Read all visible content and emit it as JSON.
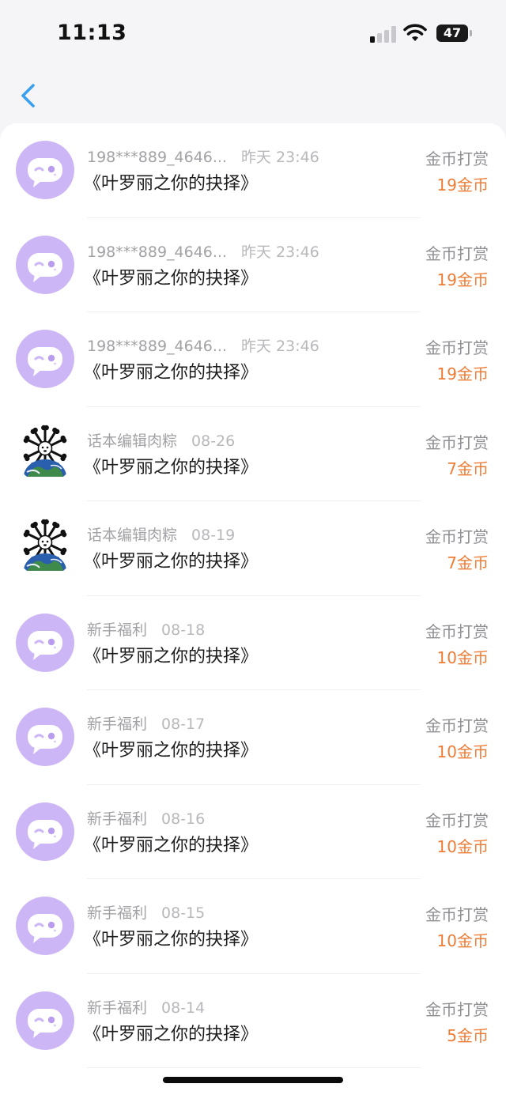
{
  "status_bar": {
    "time": "11:13",
    "battery": "47"
  },
  "colors": {
    "accent_back": "#3aa0f0",
    "amount": "#ef7c35",
    "avatar_default": "#cdb6f6"
  },
  "icons": {
    "back": "chevron-left-icon",
    "default_avatar": "chat-bubble-face-icon",
    "custom_avatar": "bone-globe-avatar"
  },
  "records": [
    {
      "user": "198***889_4646...",
      "time": "昨天 23:46",
      "book": "《叶罗丽之你的抉择》",
      "type": "金币打赏",
      "amount": "19金币",
      "avatar": "default"
    },
    {
      "user": "198***889_4646...",
      "time": "昨天 23:46",
      "book": "《叶罗丽之你的抉择》",
      "type": "金币打赏",
      "amount": "19金币",
      "avatar": "default"
    },
    {
      "user": "198***889_4646...",
      "time": "昨天 23:46",
      "book": "《叶罗丽之你的抉择》",
      "type": "金币打赏",
      "amount": "19金币",
      "avatar": "default"
    },
    {
      "user": "话本编辑肉粽",
      "time": "08-26",
      "book": "《叶罗丽之你的抉择》",
      "type": "金币打赏",
      "amount": "7金币",
      "avatar": "custom"
    },
    {
      "user": "话本编辑肉粽",
      "time": "08-19",
      "book": "《叶罗丽之你的抉择》",
      "type": "金币打赏",
      "amount": "7金币",
      "avatar": "custom"
    },
    {
      "user": "新手福利",
      "time": "08-18",
      "book": "《叶罗丽之你的抉择》",
      "type": "金币打赏",
      "amount": "10金币",
      "avatar": "default"
    },
    {
      "user": "新手福利",
      "time": "08-17",
      "book": "《叶罗丽之你的抉择》",
      "type": "金币打赏",
      "amount": "10金币",
      "avatar": "default"
    },
    {
      "user": "新手福利",
      "time": "08-16",
      "book": "《叶罗丽之你的抉择》",
      "type": "金币打赏",
      "amount": "10金币",
      "avatar": "default"
    },
    {
      "user": "新手福利",
      "time": "08-15",
      "book": "《叶罗丽之你的抉择》",
      "type": "金币打赏",
      "amount": "10金币",
      "avatar": "default"
    },
    {
      "user": "新手福利",
      "time": "08-14",
      "book": "《叶罗丽之你的抉择》",
      "type": "金币打赏",
      "amount": "5金币",
      "avatar": "default"
    }
  ]
}
